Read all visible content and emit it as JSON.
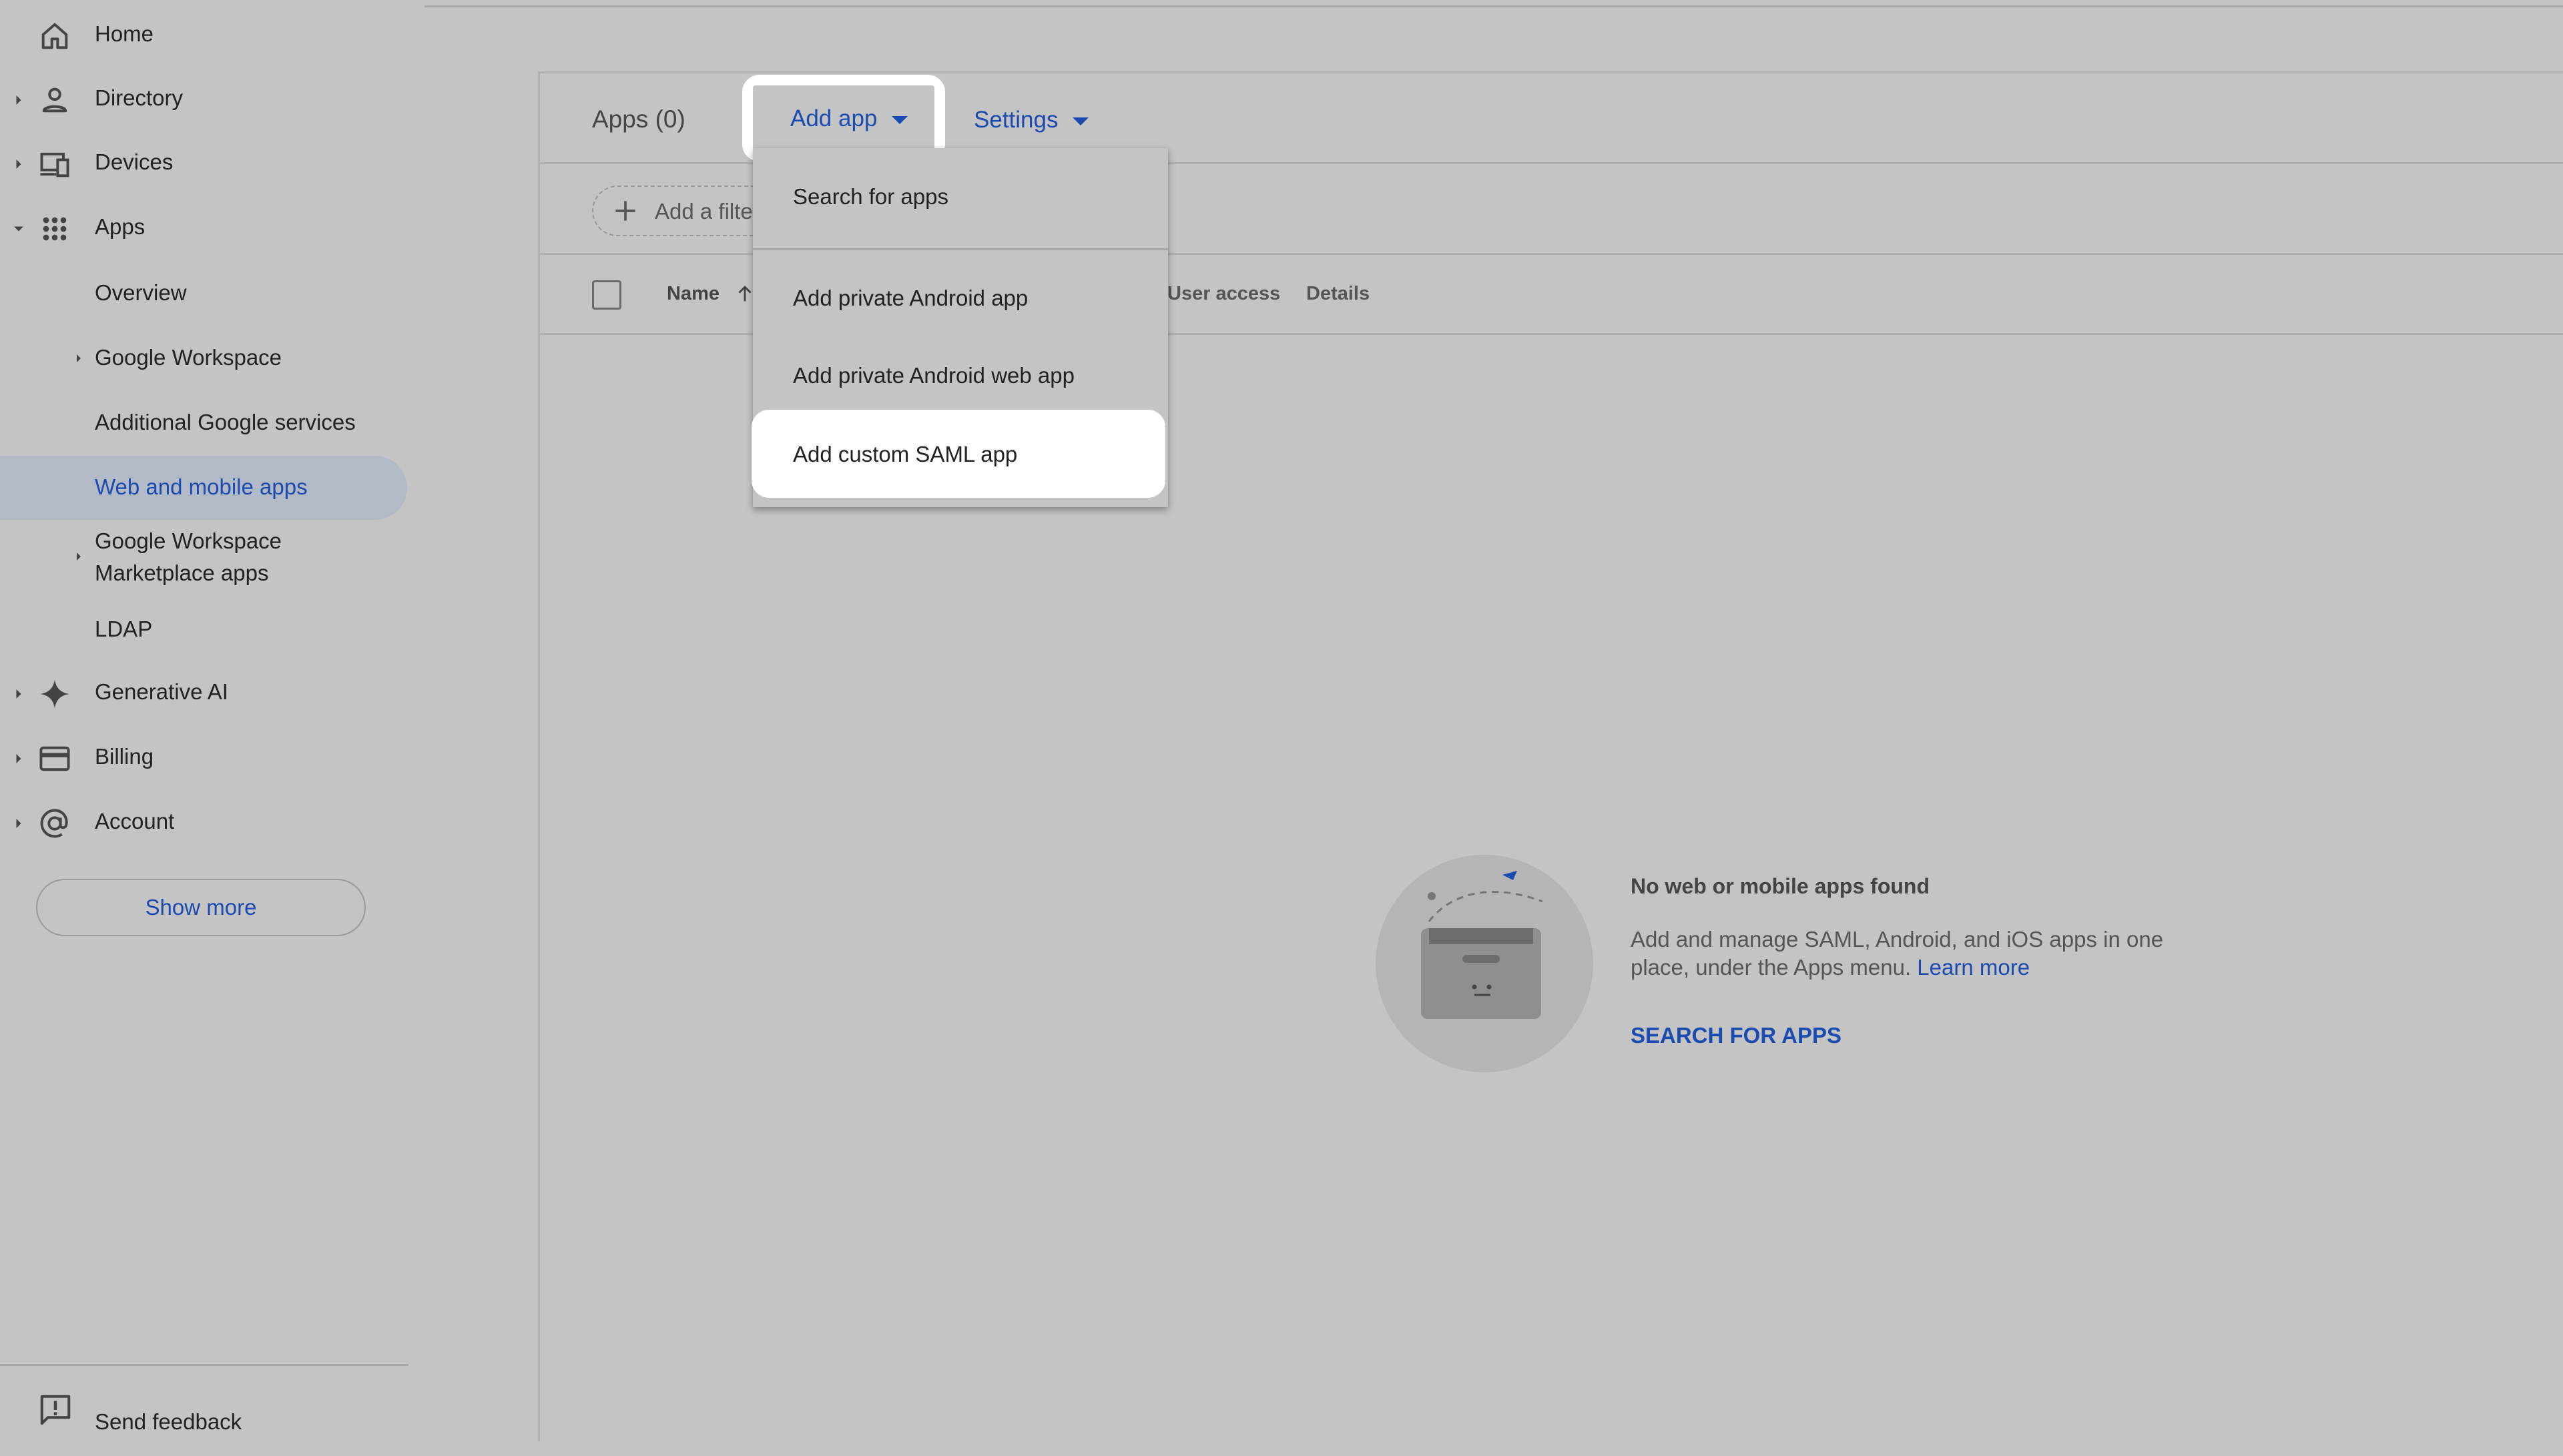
{
  "sidebar": {
    "items": [
      {
        "label": "Home",
        "icon": "home-icon",
        "expandable": false
      },
      {
        "label": "Directory",
        "icon": "person-icon",
        "expandable": true
      },
      {
        "label": "Devices",
        "icon": "devices-icon",
        "expandable": true
      },
      {
        "label": "Apps",
        "icon": "apps-grid-icon",
        "expandable": true,
        "expanded": true
      }
    ],
    "apps_children": [
      {
        "label": "Overview"
      },
      {
        "label": "Google Workspace"
      },
      {
        "label": "Additional Google services"
      },
      {
        "label": "Web and mobile apps",
        "selected": true
      },
      {
        "label_line1": "Google Workspace",
        "label_line2": "Marketplace apps"
      },
      {
        "label": "LDAP"
      }
    ],
    "more_items": [
      {
        "label": "Generative AI",
        "icon": "sparkle-icon"
      },
      {
        "label": "Billing",
        "icon": "credit-card-icon"
      },
      {
        "label": "Account",
        "icon": "at-sign-icon"
      }
    ],
    "show_more": "Show more",
    "send_feedback": "Send feedback"
  },
  "toolbar": {
    "apps_title": "Apps (0)",
    "add_app": "Add app",
    "settings": "Settings"
  },
  "filter": {
    "add_filter": "Add a filter"
  },
  "table": {
    "columns": {
      "name": "Name",
      "user_access": "User access",
      "details": "Details"
    }
  },
  "dropdown": {
    "items": [
      "Search for apps",
      "Add private Android app",
      "Add private Android web app",
      "Add custom SAML app"
    ]
  },
  "empty_state": {
    "title": "No web or mobile apps found",
    "description": "Add and manage SAML, Android, and iOS apps in one place, under the Apps menu.",
    "learn_more": "Learn more",
    "cta": "SEARCH FOR APPS"
  },
  "colors": {
    "accent": "#1a4bb1",
    "background_dimmed": "#c4c4c4",
    "highlight": "#ffffff"
  }
}
